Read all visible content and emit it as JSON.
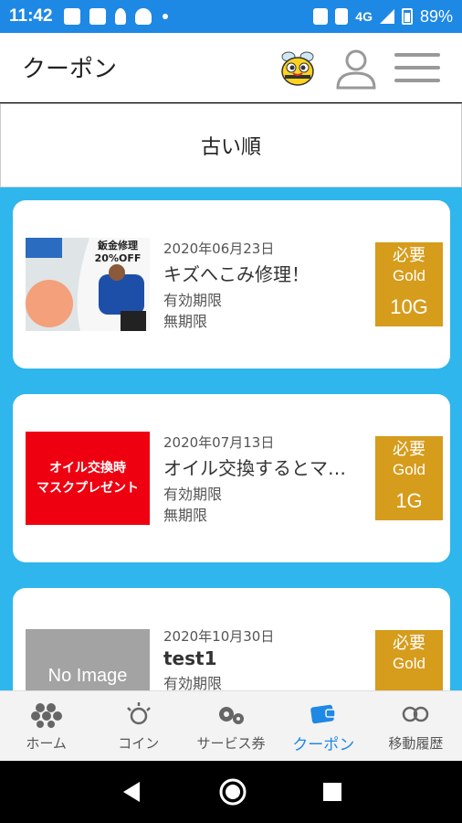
{
  "status_bar": {
    "time": "11:42",
    "network": "4G",
    "battery": "89%"
  },
  "app_bar": {
    "title": "クーポン"
  },
  "sort": {
    "label": "古い順"
  },
  "coupons": [
    {
      "date": "2020年06月23日",
      "title": "キズへこみ修理！",
      "expiry_label": "有効期限",
      "expiry": "無期限",
      "required": "必要",
      "currency": "Gold",
      "cost": "10G",
      "image_text": "鈑金修理 20%OFF"
    },
    {
      "date": "2020年07月13日",
      "title": "オイル交換するとマ…",
      "expiry_label": "有効期限",
      "expiry": "無期限",
      "required": "必要",
      "currency": "Gold",
      "cost": "1G",
      "image_line1": "オイル交換時",
      "image_line2": "マスクプレゼント"
    },
    {
      "date": "2020年10月30日",
      "title": "test1",
      "expiry_label": "有効期限",
      "required": "必要",
      "currency": "Gold",
      "image_text": "No Image"
    }
  ],
  "bottom_nav": [
    {
      "label": "ホーム",
      "icon": "home-hex-icon"
    },
    {
      "label": "コイン",
      "icon": "coin-icon"
    },
    {
      "label": "サービス券",
      "icon": "service-gear-icon"
    },
    {
      "label": "クーポン",
      "icon": "coupon-wallet-icon",
      "active": true
    },
    {
      "label": "移動履歴",
      "icon": "history-infinity-icon"
    }
  ],
  "colors": {
    "accent": "#1e88e5",
    "background": "#2fb6ec",
    "gold_badge": "#d69c1c",
    "coupon_red": "#ef0010"
  }
}
